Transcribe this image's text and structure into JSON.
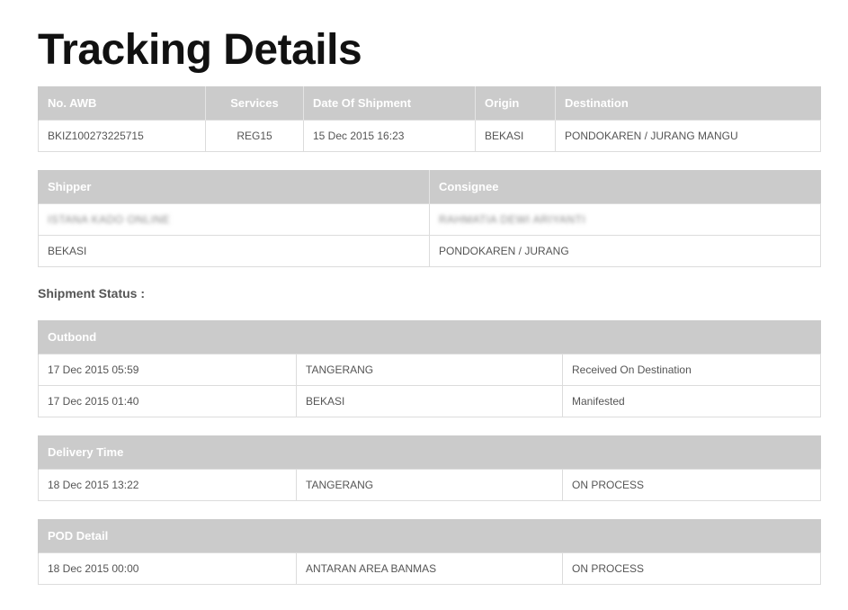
{
  "title": "Tracking Details",
  "awb_table": {
    "headers": [
      "No. AWB",
      "Services",
      "Date Of Shipment",
      "Origin",
      "Destination"
    ],
    "row": [
      "BKIZ100273225715",
      "REG15",
      "15 Dec 2015 16:23",
      "BEKASI",
      "PONDOKAREN / JURANG MANGU"
    ]
  },
  "party_table": {
    "headers": [
      "Shipper",
      "Consignee"
    ],
    "names": [
      "ISTANA KADO ONLINE",
      "RAHMATIA DEWI ARIYANTI"
    ],
    "cities": [
      "BEKASI",
      "PONDOKAREN / JURANG"
    ]
  },
  "shipment_status_label": "Shipment Status :",
  "outbond": {
    "header": "Outbond",
    "rows": [
      [
        "17 Dec 2015 05:59",
        "TANGERANG",
        "Received On Destination"
      ],
      [
        "17 Dec 2015 01:40",
        "BEKASI",
        "Manifested"
      ]
    ]
  },
  "delivery": {
    "header": "Delivery Time",
    "rows": [
      [
        "18 Dec 2015 13:22",
        "TANGERANG",
        "ON PROCESS"
      ]
    ]
  },
  "pod": {
    "header": "POD Detail",
    "rows": [
      [
        "18 Dec 2015 00:00",
        "ANTARAN AREA BANMAS",
        "ON PROCESS"
      ]
    ]
  }
}
